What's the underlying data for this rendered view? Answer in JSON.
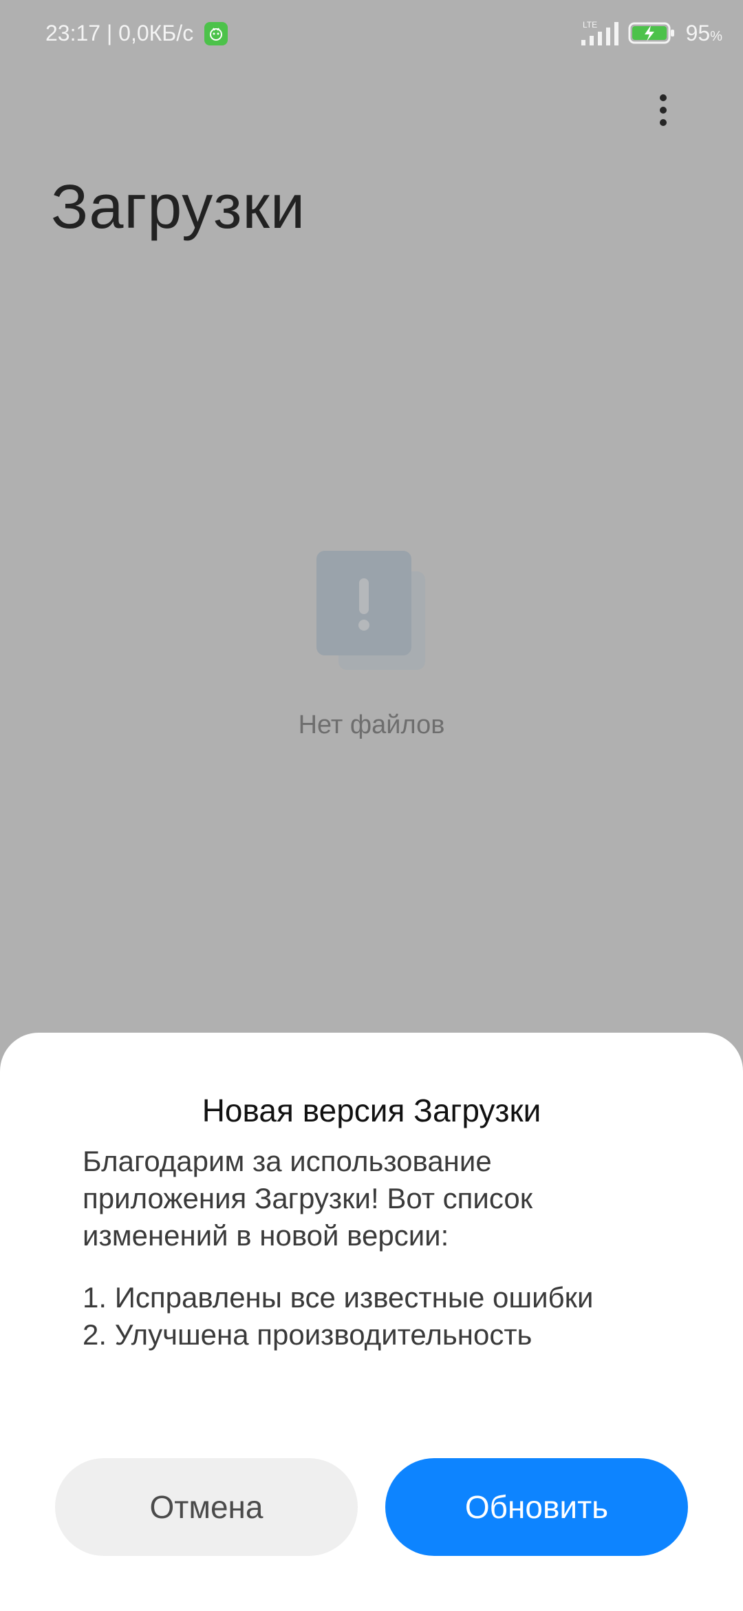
{
  "status_bar": {
    "time_speed": "23:17 | 0,0КБ/с",
    "network": "LTE",
    "battery": "95",
    "battery_unit": "%"
  },
  "header": {
    "title": "Загрузки",
    "menu_icon": "more-vertical-icon"
  },
  "empty_state": {
    "icon": "empty-file-alert-icon",
    "text": "Нет файлов"
  },
  "dialog": {
    "title": "Новая версия Загрузки",
    "body_lines": [
      "Благодарим за использование",
      "приложения Загрузки! Вот список",
      "изменений в новой версии:"
    ],
    "changes": [
      "1. Исправлены все известные ошибки",
      "2. Улучшена производительность"
    ],
    "cancel_label": "Отмена",
    "update_label": "Обновить"
  },
  "colors": {
    "overlay_background": "#b0b0b0",
    "accent": "#0d84ff",
    "cancel_bg": "#efefef",
    "app_badge": "#4cc24a"
  }
}
